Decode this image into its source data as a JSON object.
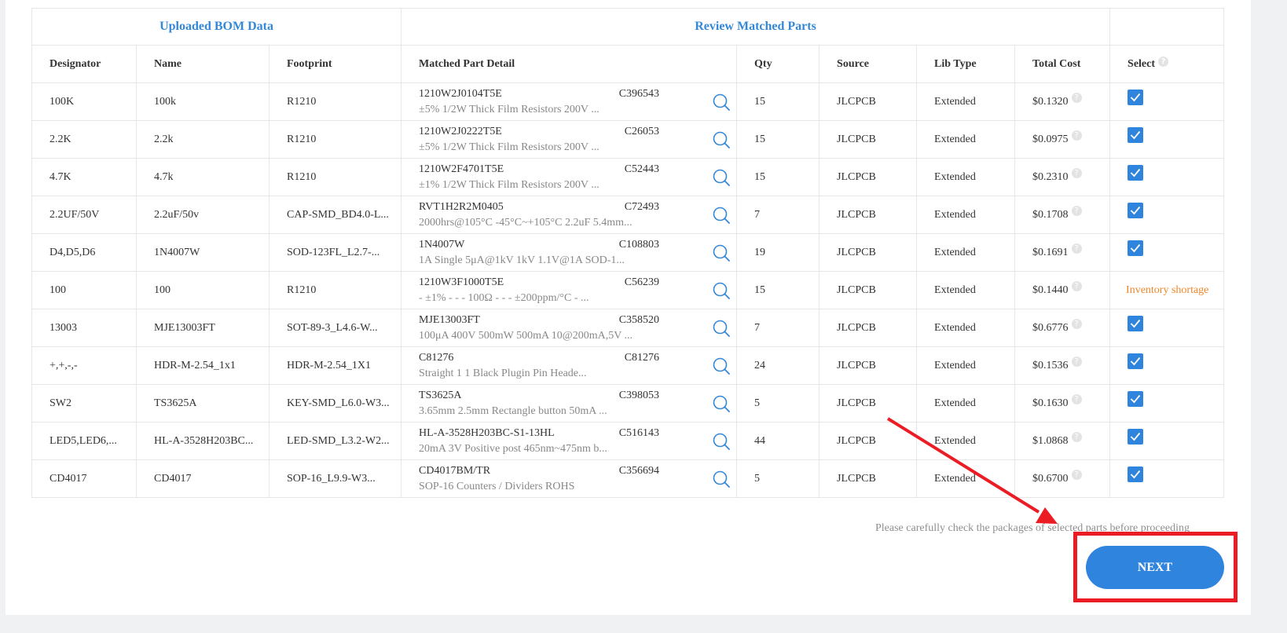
{
  "table": {
    "group_headers": {
      "left": "Uploaded BOM Data",
      "right": "Review Matched Parts"
    },
    "columns": [
      "Designator",
      "Name",
      "Footprint",
      "Matched Part Detail",
      "Qty",
      "Source",
      "Lib Type",
      "Total Cost",
      "Select"
    ],
    "rows": [
      {
        "designator": "100K",
        "name": "100k",
        "footprint": "R1210",
        "part": "1210W2J0104T5E",
        "code": "C396543",
        "desc": "±5% 1/2W Thick Film Resistors 200V ...",
        "qty": "15",
        "source": "JLCPCB",
        "lib": "Extended",
        "cost": "$0.1320",
        "selected": true
      },
      {
        "designator": "2.2K",
        "name": "2.2k",
        "footprint": "R1210",
        "part": "1210W2J0222T5E",
        "code": "C26053",
        "desc": "±5% 1/2W Thick Film Resistors 200V ...",
        "qty": "15",
        "source": "JLCPCB",
        "lib": "Extended",
        "cost": "$0.0975",
        "selected": true
      },
      {
        "designator": "4.7K",
        "name": "4.7k",
        "footprint": "R1210",
        "part": "1210W2F4701T5E",
        "code": "C52443",
        "desc": "±1% 1/2W Thick Film Resistors 200V ...",
        "qty": "15",
        "source": "JLCPCB",
        "lib": "Extended",
        "cost": "$0.2310",
        "selected": true
      },
      {
        "designator": "2.2UF/50V",
        "name": "2.2uF/50v",
        "footprint": "CAP-SMD_BD4.0-L...",
        "part": "RVT1H2R2M0405",
        "code": "C72493",
        "desc": "2000hrs@105°C -45°C~+105°C 2.2uF 5.4mm...",
        "qty": "7",
        "source": "JLCPCB",
        "lib": "Extended",
        "cost": "$0.1708",
        "selected": true
      },
      {
        "designator": "D4,D5,D6",
        "name": "1N4007W",
        "footprint": "SOD-123FL_L2.7-...",
        "part": "1N4007W",
        "code": "C108803",
        "desc": "1A Single 5μA@1kV 1kV 1.1V@1A SOD-1...",
        "qty": "19",
        "source": "JLCPCB",
        "lib": "Extended",
        "cost": "$0.1691",
        "selected": true
      },
      {
        "designator": "100",
        "name": "100",
        "footprint": "R1210",
        "part": "1210W3F1000T5E",
        "code": "C56239",
        "desc": "- ±1% - - - 100Ω - - - ±200ppm/°C - ...",
        "qty": "15",
        "source": "JLCPCB",
        "lib": "Extended",
        "cost": "$0.1440",
        "selected": false,
        "status": "Inventory shortage"
      },
      {
        "designator": "13003",
        "name": "MJE13003FT",
        "footprint": "SOT-89-3_L4.6-W...",
        "part": "MJE13003FT",
        "code": "C358520",
        "desc": "100μA 400V 500mW 500mA 10@200mA,5V ...",
        "qty": "7",
        "source": "JLCPCB",
        "lib": "Extended",
        "cost": "$0.6776",
        "selected": true
      },
      {
        "designator": "+,+,-,-",
        "name": "HDR-M-2.54_1x1",
        "footprint": "HDR-M-2.54_1X1",
        "part": "C81276",
        "code": "C81276",
        "desc": "Straight 1 1 Black Plugin Pin Heade...",
        "qty": "24",
        "source": "JLCPCB",
        "lib": "Extended",
        "cost": "$0.1536",
        "selected": true
      },
      {
        "designator": "SW2",
        "name": "TS3625A",
        "footprint": "KEY-SMD_L6.0-W3...",
        "part": "TS3625A",
        "code": "C398053",
        "desc": "3.65mm 2.5mm Rectangle button 50mA ...",
        "qty": "5",
        "source": "JLCPCB",
        "lib": "Extended",
        "cost": "$0.1630",
        "selected": true
      },
      {
        "designator": "LED5,LED6,...",
        "name": "HL-A-3528H203BC...",
        "footprint": "LED-SMD_L3.2-W2...",
        "part": "HL-A-3528H203BC-S1-13HL",
        "code": "C516143",
        "desc": "20mA 3V Positive post 465nm~475nm b...",
        "qty": "44",
        "source": "JLCPCB",
        "lib": "Extended",
        "cost": "$1.0868",
        "selected": true
      },
      {
        "designator": "CD4017",
        "name": "CD4017",
        "footprint": "SOP-16_L9.9-W3...",
        "part": "CD4017BM/TR",
        "code": "C356694",
        "desc": "SOP-16 Counters / Dividers ROHS",
        "qty": "5",
        "source": "JLCPCB",
        "lib": "Extended",
        "cost": "$0.6700",
        "selected": true
      }
    ]
  },
  "notice": "Please carefully check the packages of selected parts before proceeding",
  "next_label": "NEXT",
  "colors": {
    "accent": "#2f84dd",
    "annotation": "#ec1c24",
    "warning": "#f0862b"
  }
}
